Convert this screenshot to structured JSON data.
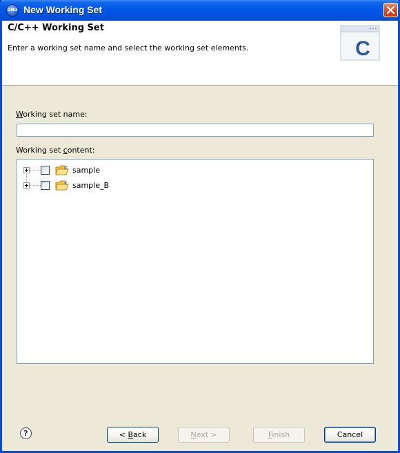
{
  "window": {
    "title": "New Working Set",
    "app_badge": "GNU"
  },
  "header": {
    "title": "C/C++ Working Set",
    "description": "Enter a working set name and select the working set elements.",
    "banner_letter": "C"
  },
  "form": {
    "name_label_mnemonic": "W",
    "name_label_rest": "orking set name:",
    "name_value": "",
    "content_label_prefix": "Working set ",
    "content_label_mnemonic": "c",
    "content_label_rest": "ontent:"
  },
  "tree": {
    "items": [
      {
        "label": "sample",
        "checked": false,
        "expanded": false
      },
      {
        "label": "sample_B",
        "checked": false,
        "expanded": false
      }
    ]
  },
  "buttons": {
    "help_glyph": "?",
    "back_prefix": "< ",
    "back_mnemonic": "B",
    "back_rest": "ack",
    "next_mnemonic": "N",
    "next_rest": "ext >",
    "finish_mnemonic": "F",
    "finish_rest": "inish",
    "cancel": "Cancel"
  },
  "colors": {
    "titlebar": "#0058e6",
    "dialog_bg": "#ece9d8",
    "folder": "#f3c349"
  }
}
